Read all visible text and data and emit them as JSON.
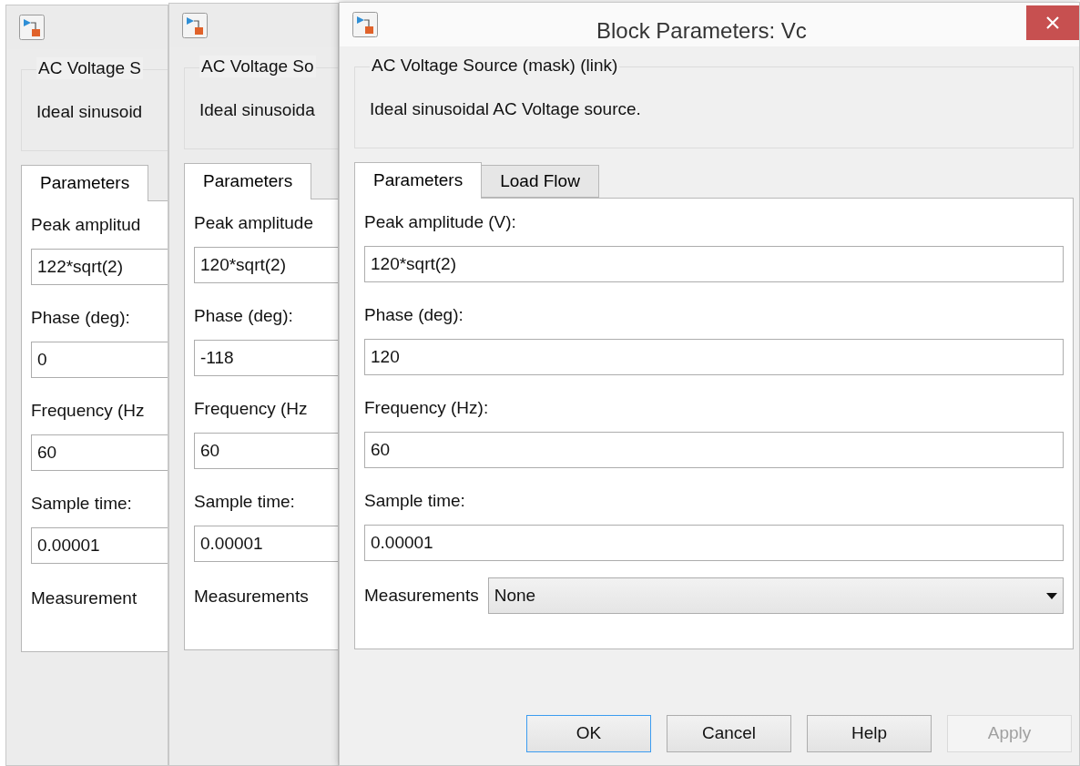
{
  "windows": [
    {
      "group_title": "AC Voltage S",
      "description": "Ideal sinusoid",
      "tabs": [
        {
          "label": "Parameters",
          "selected": true
        }
      ],
      "fields": [
        {
          "label": "Peak amplitud",
          "value": "122*sqrt(2)"
        },
        {
          "label": "Phase (deg):",
          "value": "0"
        },
        {
          "label": "Frequency (Hz",
          "value": "60"
        },
        {
          "label": "Sample time:",
          "value": "0.00001"
        }
      ],
      "measurements": {
        "label": "Measurement"
      }
    },
    {
      "group_title": "AC Voltage So",
      "description": "Ideal sinusoida",
      "tabs": [
        {
          "label": "Parameters",
          "selected": true
        }
      ],
      "fields": [
        {
          "label": "Peak amplitude",
          "value": "120*sqrt(2)"
        },
        {
          "label": "Phase (deg):",
          "value": "-118"
        },
        {
          "label": "Frequency (Hz",
          "value": "60"
        },
        {
          "label": "Sample time:",
          "value": "0.00001"
        }
      ],
      "measurements": {
        "label": "Measurements"
      }
    },
    {
      "title": "Block Parameters: Vc",
      "group_title": "AC Voltage Source (mask) (link)",
      "description": "Ideal sinusoidal AC Voltage source.",
      "tabs": [
        {
          "label": "Parameters",
          "selected": true
        },
        {
          "label": "Load Flow",
          "selected": false
        }
      ],
      "fields": [
        {
          "label": "Peak amplitude (V):",
          "value": "120*sqrt(2)"
        },
        {
          "label": "Phase (deg):",
          "value": "120"
        },
        {
          "label": "Frequency (Hz):",
          "value": "60"
        },
        {
          "label": "Sample time:",
          "value": "0.00001"
        }
      ],
      "measurements": {
        "label": "Measurements",
        "value": "None"
      },
      "buttons": [
        {
          "label": "OK",
          "disabled": false,
          "focused": true
        },
        {
          "label": "Cancel",
          "disabled": false,
          "focused": false
        },
        {
          "label": "Help",
          "disabled": false,
          "focused": false
        },
        {
          "label": "Apply",
          "disabled": true,
          "focused": false
        }
      ]
    }
  ]
}
